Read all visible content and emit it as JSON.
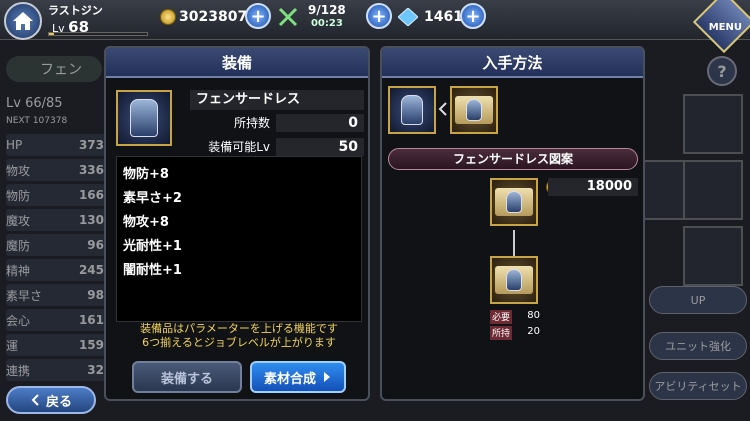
{
  "player": {
    "name": "ラストジン",
    "level_prefix": "Lv",
    "level": "68",
    "exp_progress": 0.05
  },
  "resources": {
    "gil": "3023807",
    "stamina": "9/128",
    "stamina_timer": "00:23",
    "lapis": "1461",
    "plus_glyph": "+"
  },
  "menu_label": "MENU",
  "background": {
    "unit_name": "フェン",
    "level_label": "Lv",
    "level": "66/85",
    "next_label": "NEXT",
    "next_value": "107378",
    "stats": [
      {
        "label": "HP",
        "value": "373"
      },
      {
        "label": "物攻",
        "value": "336"
      },
      {
        "label": "物防",
        "value": "166"
      },
      {
        "label": "魔攻",
        "value": "130"
      },
      {
        "label": "魔防",
        "value": "96"
      },
      {
        "label": "精神",
        "value": "245"
      },
      {
        "label": "素早さ",
        "value": "98"
      },
      {
        "label": "会心",
        "value": "161"
      },
      {
        "label": "運",
        "value": "159"
      },
      {
        "label": "連携",
        "value": "32"
      }
    ],
    "back_label": "戻る",
    "help_label": "?",
    "right_buttons": [
      "UP",
      "ユニット強化",
      "アビリティセット"
    ]
  },
  "equip_panel": {
    "title": "装備",
    "item_name": "フェンサードレス",
    "owned_label": "所持数",
    "owned_value": "0",
    "equip_lv_label": "装備可能Lv",
    "equip_lv_value": "50",
    "stats": [
      "物防+8",
      "素早さ+2",
      "物攻+8",
      "光耐性+1",
      "闇耐性+1"
    ],
    "description_1": "装備品はパラメーターを上げる機能です",
    "description_2": "6つ揃えるとジョブレベルが上がります",
    "equip_button": "装備する",
    "synth_button": "素材合成"
  },
  "source_panel": {
    "title": "入手方法",
    "recipe_name": "フェンサードレス図案",
    "gil_cost": "18000",
    "required_label": "必要",
    "required_value": "80",
    "owned_label": "所持",
    "owned_value": "20"
  },
  "colors": {
    "gold_text": "#f2d35a",
    "panel_head": "#2b3a66",
    "synth_blue": "#1f6fe0"
  }
}
